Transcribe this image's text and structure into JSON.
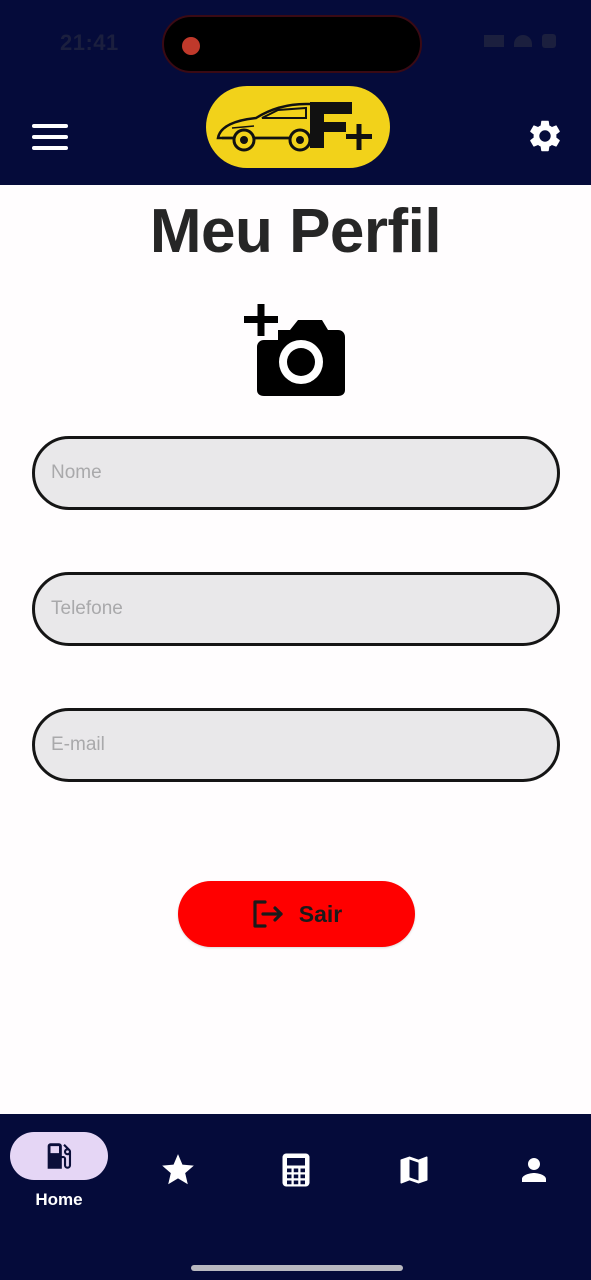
{
  "status_bar": {
    "time": "21:41"
  },
  "header": {
    "menu_icon": "hamburger-menu-icon",
    "logo_text": "F+",
    "settings_icon": "gear-icon",
    "colors": {
      "background": "#050b3a",
      "logo_bg": "#f2d21a"
    }
  },
  "page": {
    "title": "Meu Perfil",
    "add_photo_icon": "add-camera-icon"
  },
  "form": {
    "name_placeholder": "Nome",
    "phone_placeholder": "Telefone",
    "email_placeholder": "E-mail"
  },
  "logout": {
    "label": "Sair",
    "icon": "logout-icon",
    "color": "#ff0000"
  },
  "bottom_nav": {
    "items": [
      {
        "label": "Home",
        "icon": "fuel-pump-icon",
        "active": true
      },
      {
        "label": "",
        "icon": "star-icon",
        "active": false
      },
      {
        "label": "",
        "icon": "calculator-icon",
        "active": false
      },
      {
        "label": "",
        "icon": "map-icon",
        "active": false
      },
      {
        "label": "",
        "icon": "person-icon",
        "active": false
      }
    ],
    "active_color": "#e5d6f5"
  }
}
